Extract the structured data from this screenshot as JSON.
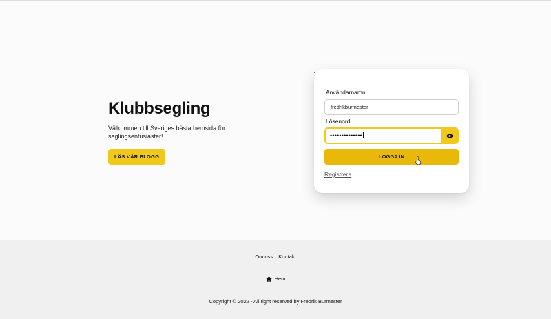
{
  "hero": {
    "title": "Klubbsegling",
    "subtitle": "Välkommen till Sveriges bästa hemsida för seglingsentusiaster!",
    "cta_label": "LÄS VÅR BLOGG"
  },
  "login": {
    "username_label": "Användarnamn",
    "username_value": "fredrikburmester",
    "password_label": "Lösenord",
    "password_masked": "••••••••••••••",
    "submit_label": "LOGGA IN",
    "register_label": "Registrera"
  },
  "footer": {
    "links": [
      "Om oss",
      "Kontakt"
    ],
    "home_label": "Hem",
    "copyright": "Copyright © 2022 - All right reserved by Fredrik Burmester"
  },
  "colors": {
    "accent": "#f1c81c",
    "button": "#e8b90a",
    "footer_bg": "#f0f0f0"
  },
  "icons": {
    "show_password": "eye-icon",
    "home": "home-icon",
    "cursor": "hand-pointer-icon"
  }
}
